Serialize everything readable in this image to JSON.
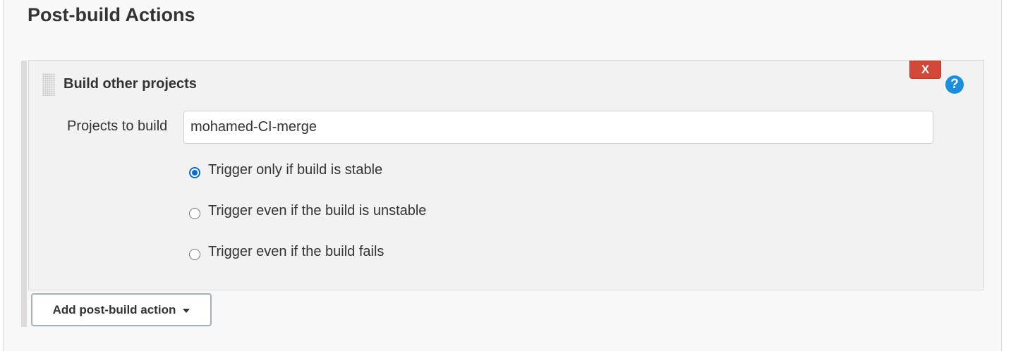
{
  "section": {
    "title": "Post-build Actions"
  },
  "action": {
    "title": "Build other projects",
    "delete_label": "X",
    "help_label": "?",
    "projects_label": "Projects to build",
    "projects_value": "mohamed-CI-merge",
    "options": [
      {
        "label": "Trigger only if build is stable",
        "selected": true
      },
      {
        "label": "Trigger even if the build is unstable",
        "selected": false
      },
      {
        "label": "Trigger even if the build fails",
        "selected": false
      }
    ]
  },
  "add_button": {
    "label": "Add post-build action",
    "icon": "caret-down-icon"
  },
  "colors": {
    "delete_button": "#d24939",
    "help_icon": "#1a8fe0",
    "radio_selected": "#0a6bd8"
  }
}
